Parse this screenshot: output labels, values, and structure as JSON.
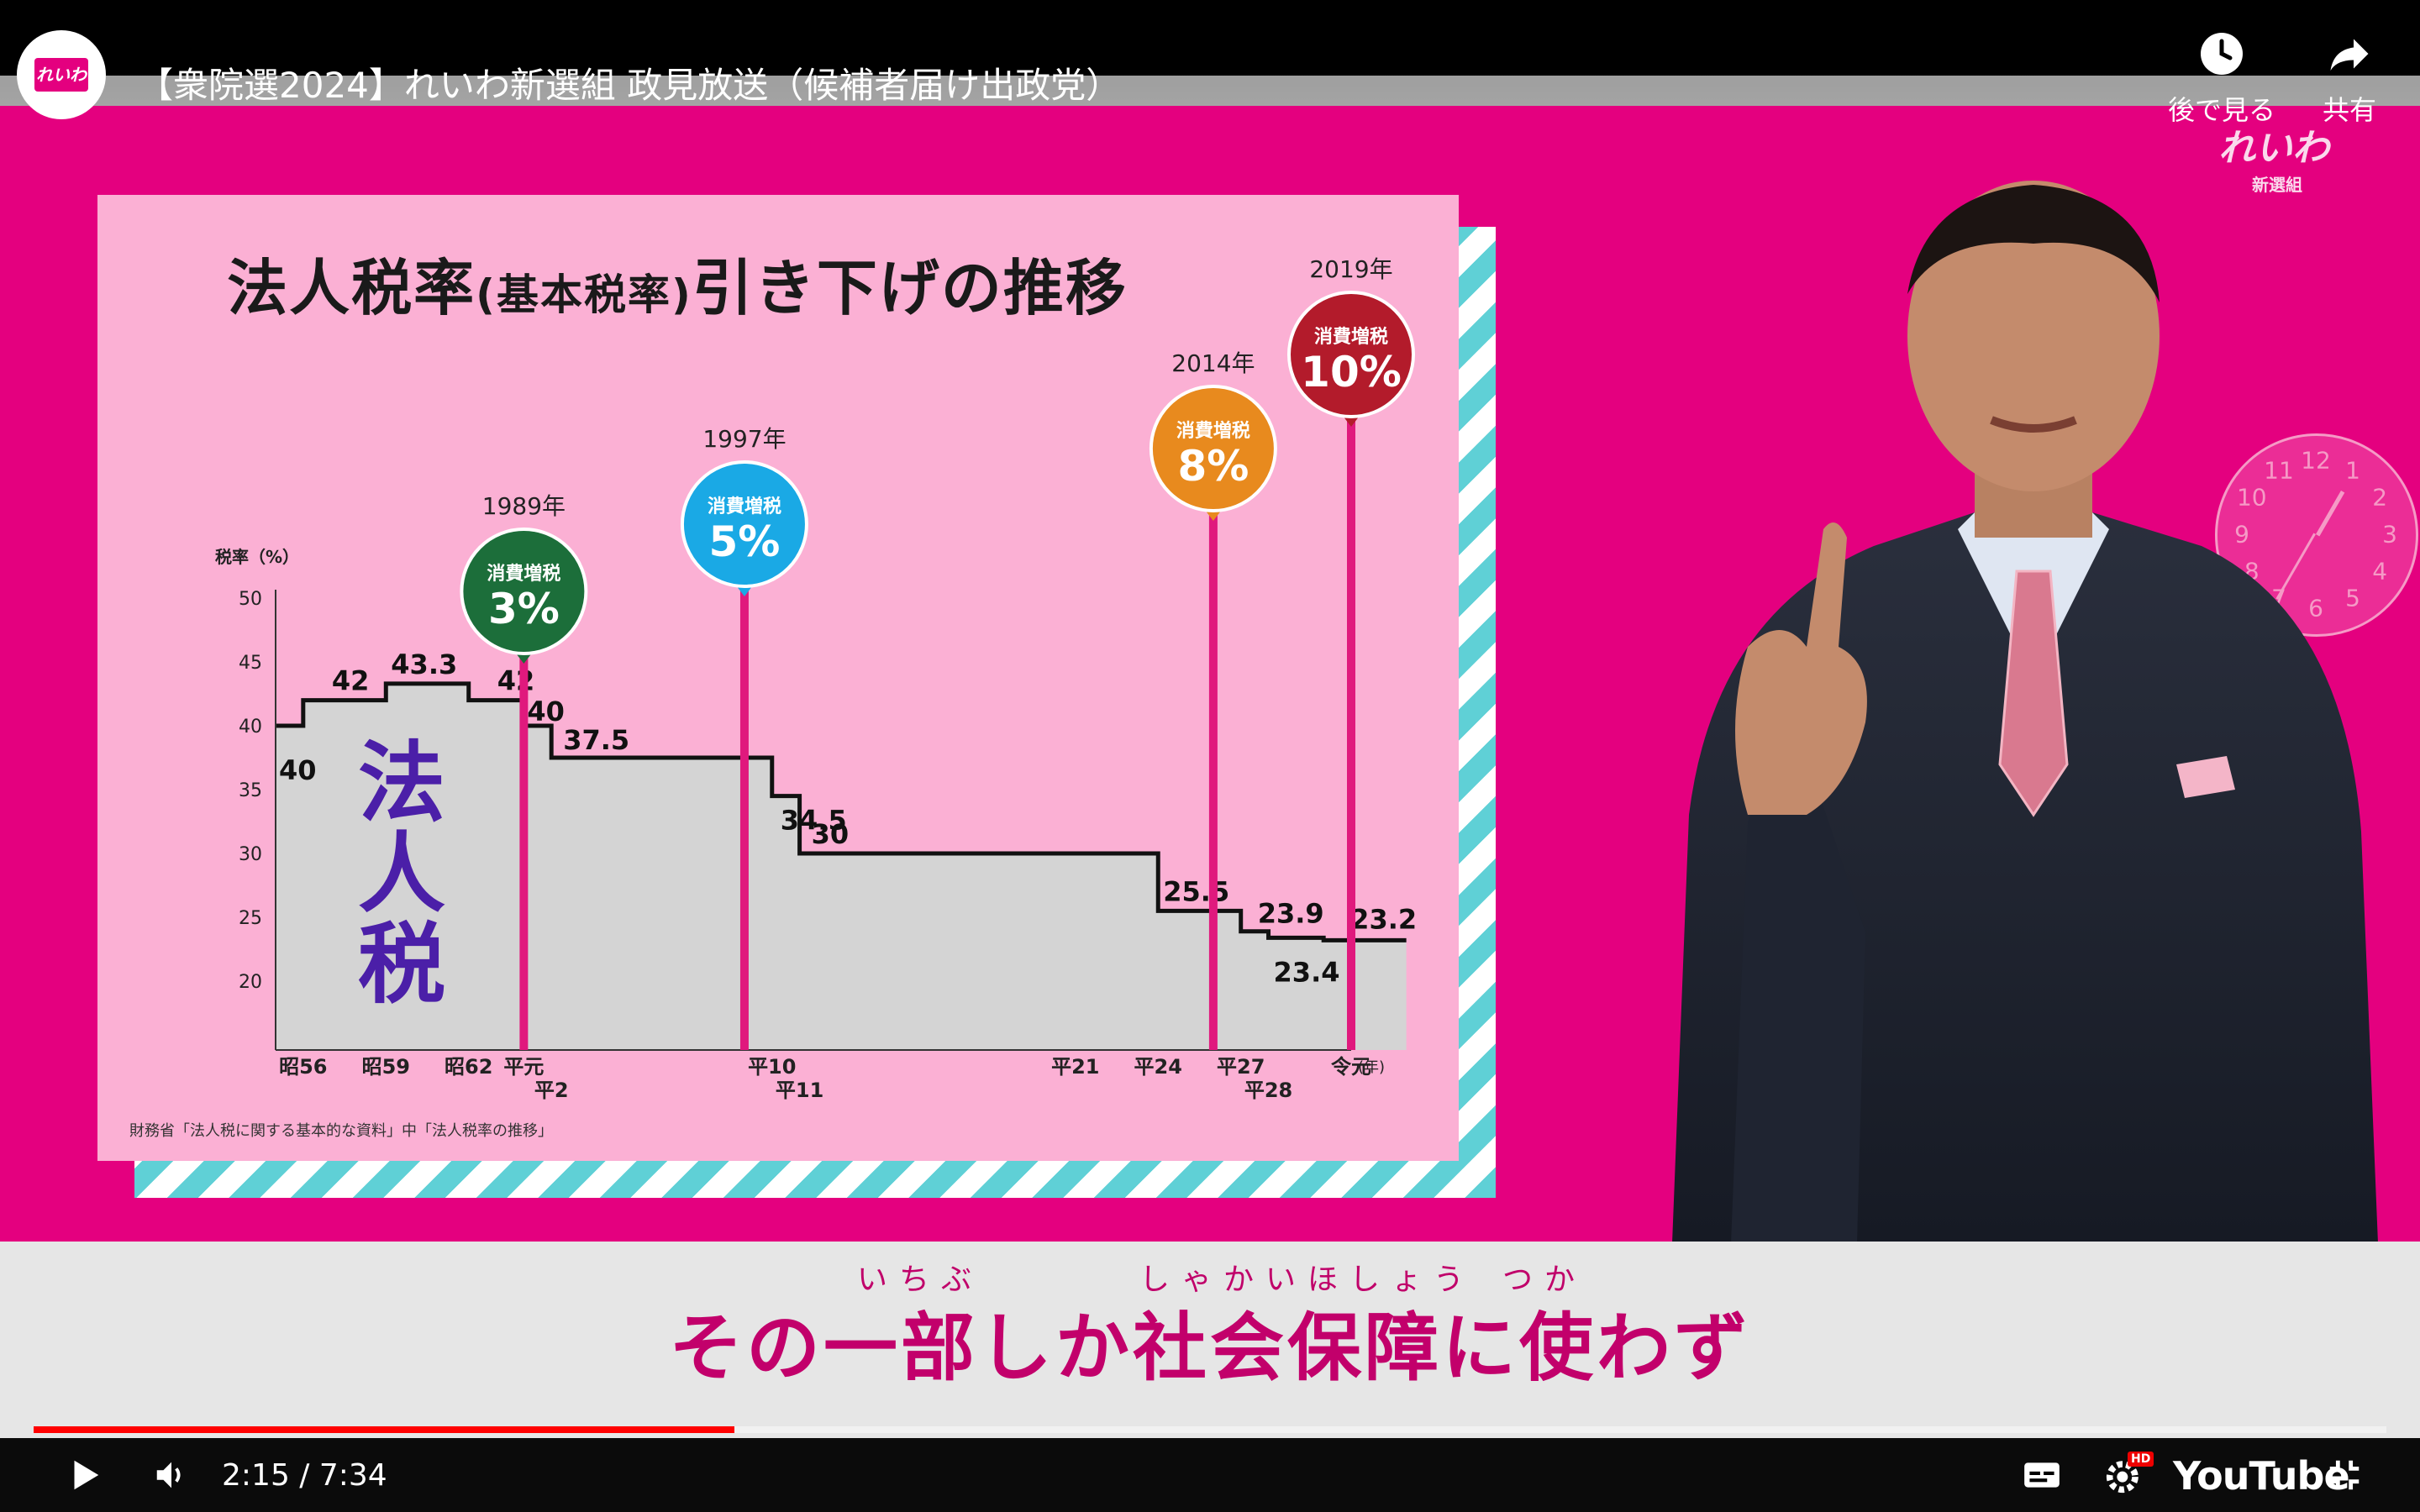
{
  "video": {
    "title": "【衆院選2024】れいわ新選組 政見放送（候補者届け出政党）",
    "channel_logo_text": "れいわ",
    "watch_later_label": "後で見る",
    "share_label": "共有",
    "watermark_text": "れいわ",
    "watermark_sub": "新選組"
  },
  "board": {
    "title_main_1": "法人税率",
    "title_paren": "(基本税率)",
    "title_main_2": "引き下げの推移",
    "source": "財務省「法人税に関する基本的な資料」中「法人税率の推移」",
    "side_label_1": "法",
    "side_label_2": "人",
    "side_label_3": "税"
  },
  "chart_data": {
    "type": "line",
    "step": true,
    "title": "法人税率(基本税率)引き下げの推移",
    "ylabel": "税率（%）",
    "xlabel": "(年)",
    "ylim": [
      15,
      50
    ],
    "yticks": [
      50,
      45,
      40,
      35,
      30,
      25,
      20
    ],
    "xticks": [
      "昭56",
      "昭59",
      "昭62",
      "平元",
      "平2",
      "平10",
      "平11",
      "平21",
      "平24",
      "平27",
      "平28",
      "令元"
    ],
    "series": [
      {
        "points": [
          {
            "year": 1980,
            "value": 40,
            "label": "40"
          },
          {
            "year": 1981,
            "value": 42,
            "label": "42"
          },
          {
            "year": 1984,
            "value": 43.3,
            "label": "43.3"
          },
          {
            "year": 1987,
            "value": 42,
            "label": "42"
          },
          {
            "year": 1989,
            "value": 40,
            "label": "40"
          },
          {
            "year": 1990,
            "value": 37.5,
            "label": "37.5"
          },
          {
            "year": 1998,
            "value": 34.5,
            "label": "34.5"
          },
          {
            "year": 1999,
            "value": 30,
            "label": "30"
          },
          {
            "year": 2012,
            "value": 25.5,
            "label": "25.5"
          },
          {
            "year": 2015,
            "value": 23.9,
            "label": "23.9"
          },
          {
            "year": 2016,
            "value": 23.4,
            "label": "23.4"
          },
          {
            "year": 2018,
            "value": 23.2,
            "label": "23.2"
          }
        ]
      }
    ],
    "annotations": [
      {
        "year_label": "1989年",
        "year": 1989,
        "text": "消費増税",
        "rate": "3%",
        "color": "#1c6e3a"
      },
      {
        "year_label": "1997年",
        "year": 1997,
        "text": "消費増税",
        "rate": "5%",
        "color": "#1aa9e5"
      },
      {
        "year_label": "2014年",
        "year": 2014,
        "text": "消費増税",
        "rate": "8%",
        "color": "#e88a1e"
      },
      {
        "year_label": "2019年",
        "year": 2019,
        "text": "消費増税",
        "rate": "10%",
        "color": "#b31b2b"
      }
    ]
  },
  "subtitle": {
    "text": "その一部しか社会保障に使わず",
    "ruby_1": "いちぶ",
    "ruby_2": "しゃかいほしょう",
    "ruby_3": "つか"
  },
  "player": {
    "current_time": "2:15",
    "duration": "7:34",
    "time_display": "2:15 / 7:34",
    "progress": 0.298,
    "settings_badge": "HD",
    "brand": "YouTube"
  },
  "colors": {
    "background": "#e4007f",
    "board": "#fbb0d4",
    "accent_line": "#e0197d",
    "subtitle": "#c2006b",
    "progress": "#ff0000"
  },
  "icons": [
    "watch-later-icon",
    "share-icon",
    "play-icon",
    "volume-icon",
    "captions-icon",
    "settings-icon",
    "fullscreen-exit-icon"
  ]
}
